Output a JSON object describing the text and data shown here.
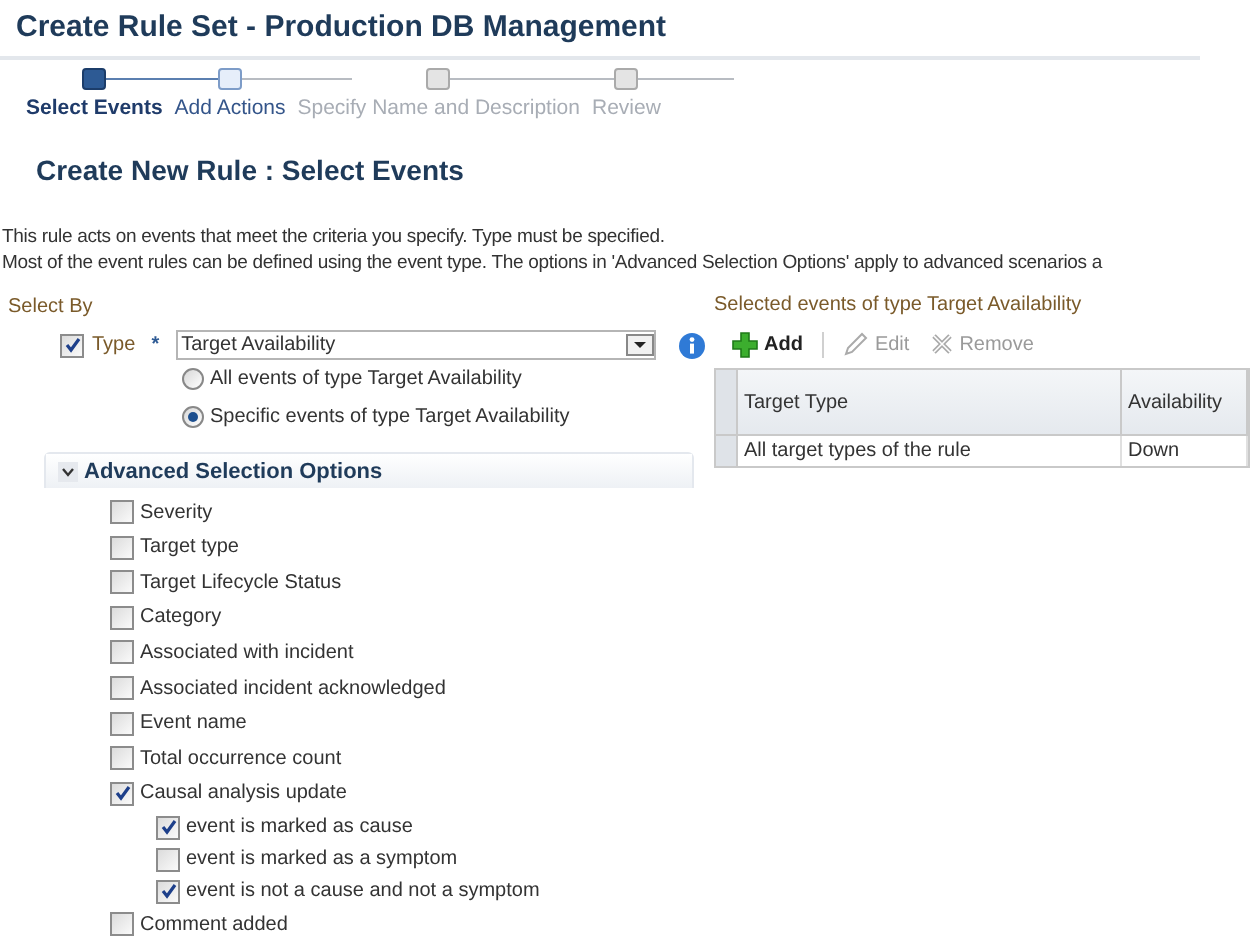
{
  "window": {
    "title": "Create Rule Set - Production DB Management"
  },
  "steps": [
    {
      "label": "Select Events",
      "selected": true,
      "disabled": false
    },
    {
      "label": "Add Actions",
      "selected": false,
      "disabled": false
    },
    {
      "label": "Specify Name and Description",
      "selected": false,
      "disabled": true
    },
    {
      "label": "Review",
      "selected": false,
      "disabled": true
    }
  ],
  "heading": "Create New Rule : Select Events",
  "description": [
    "This rule acts on events that meet the criteria you specify. Type must be specified.",
    "Most of the event rules can be defined using the event type. The options in 'Advanced Selection Options' apply to advanced scenarios a"
  ],
  "select_by": {
    "label": "Select By",
    "type": {
      "label": "Type",
      "checked": true,
      "required_mark": "*",
      "value": "Target Availability"
    },
    "radios": [
      {
        "label": "All events of type Target Availability",
        "selected": false
      },
      {
        "label": "Specific events of type Target Availability",
        "selected": true
      }
    ]
  },
  "advanced": {
    "title": "Advanced Selection Options",
    "expanded": true,
    "options": [
      {
        "label": "Severity",
        "checked": false
      },
      {
        "label": "Target type",
        "checked": false
      },
      {
        "label": "Target Lifecycle Status",
        "checked": false
      },
      {
        "label": "Category",
        "checked": false
      },
      {
        "label": "Associated with incident",
        "checked": false
      },
      {
        "label": "Associated incident acknowledged",
        "checked": false
      },
      {
        "label": "Event name",
        "checked": false
      },
      {
        "label": "Total occurrence count",
        "checked": false
      },
      {
        "label": "Causal analysis update",
        "checked": true,
        "children": [
          {
            "label": "event is marked as cause",
            "checked": true
          },
          {
            "label": "event is marked as a symptom",
            "checked": false
          },
          {
            "label": "event is not a cause and not a symptom",
            "checked": true
          }
        ]
      },
      {
        "label": "Comment added",
        "checked": false
      }
    ]
  },
  "selected_events": {
    "label": "Selected events of type Target Availability",
    "toolbar": [
      {
        "kind": "add",
        "label": "Add",
        "disabled": false
      },
      {
        "kind": "edit",
        "label": "Edit",
        "disabled": true
      },
      {
        "kind": "remove",
        "label": "Remove",
        "disabled": true
      }
    ],
    "table": {
      "columns": [
        "Target Type",
        "Availability"
      ],
      "rows": [
        [
          "All target types of the rule",
          "Down"
        ]
      ]
    }
  }
}
